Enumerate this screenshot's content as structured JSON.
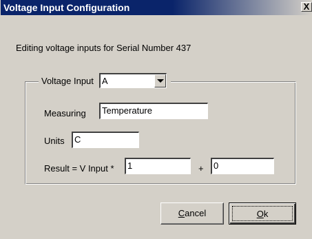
{
  "window": {
    "title": "Voltage Input Configuration",
    "close_glyph": "X"
  },
  "editing_text": "Editing voltage inputs for Serial Number 437",
  "group": {
    "label": "Voltage Input",
    "selected_input": "A"
  },
  "fields": {
    "measuring_label": "Measuring",
    "measuring_value": "Temperature",
    "units_label": "Units",
    "units_value": "C",
    "result_label": "Result = V Input *",
    "multiplier_value": "1",
    "plus_label": "+",
    "offset_value": "0"
  },
  "buttons": {
    "cancel_mnemonic": "C",
    "cancel_rest": "ancel",
    "ok_mnemonic": "O",
    "ok_rest": "k"
  },
  "colors": {
    "titlebar": "#0a246a",
    "face": "#d4d0c8"
  }
}
